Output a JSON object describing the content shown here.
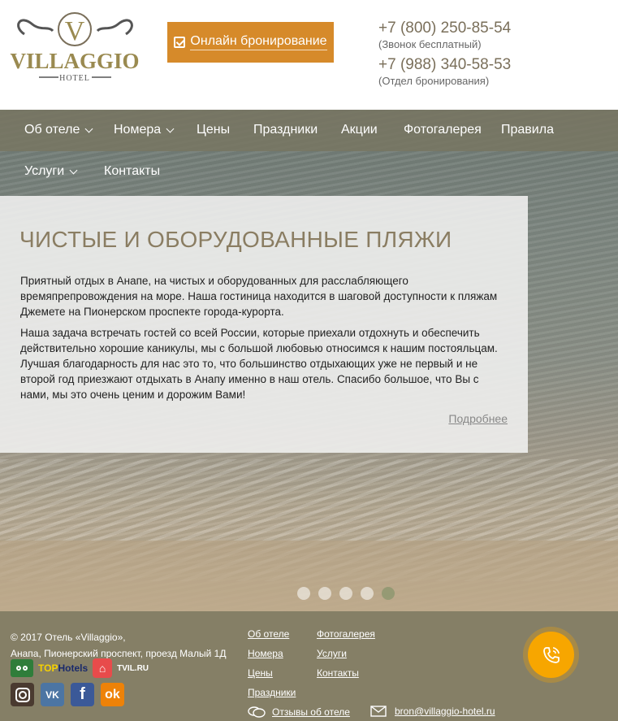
{
  "header": {
    "logo": {
      "brand": "VILLAGGIO",
      "sub": "HOTEL",
      "monogram": "V"
    },
    "booking_label": "Онлайн бронирование",
    "phones": [
      {
        "number": "+7 (800) 250-85-54",
        "note": "(Звонок бесплатный)"
      },
      {
        "number": "+7 (988) 340-58-53",
        "note": "(Отдел бронирования)"
      }
    ]
  },
  "nav": {
    "items": [
      {
        "label": "Об отеле",
        "dropdown": true
      },
      {
        "label": "Номера",
        "dropdown": true
      },
      {
        "label": "Цены"
      },
      {
        "label": "Праздники"
      },
      {
        "label": "Акции"
      },
      {
        "label": "Фотогалерея"
      },
      {
        "label": "Правила"
      },
      {
        "label": "Услуги",
        "dropdown": true
      },
      {
        "label": "Контакты"
      }
    ]
  },
  "hero": {
    "title": "ЧИСТЫЕ И ОБОРУДОВАННЫЕ ПЛЯЖИ",
    "paragraph1": "Приятный отдых в Анапе, на чистых и оборудованных для расслабляющего времяпрепровождения на море. Наша гостиница находится в шаговой доступности к пляжам Джемете на Пионерском проспекте города-курорта.",
    "paragraph2": "Наша задача встречать гостей со всей России, которые приехали отдохнуть и обеспечить действительно хорошие каникулы, мы с большой любовью относимся к нашим постояльцам. Лучшая благодарность для нас это то, что большинство отдыхающих уже не первый и не второй год приезжают отдыхать в Анапу именно в наш отель. Спасибо большое, что Вы с нами, мы это очень ценим и дорожим Вами!",
    "more_label": "Подробнее",
    "slides_count": 5,
    "active_slide": 5
  },
  "footer": {
    "copyright": "© 2017 Отель «Villaggio»,",
    "address": "Анапа, Пионерский проспект, проезд Малый 1Д",
    "badges": {
      "top_hotels": "TOP",
      "top_hotels_b": "Hotels",
      "tvil": "TVIL.RU"
    },
    "socials": {
      "vk": "VK",
      "fb": "f",
      "ok": "ok"
    },
    "links_col1": [
      "Об отеле",
      "Номера",
      "Цены",
      "Праздники"
    ],
    "links_col2": [
      "Фотогалерея",
      "Услуги",
      "Контакты"
    ],
    "reviews_label": "Отзывы об отеле",
    "email": "bron@villaggio-hotel.ru"
  },
  "colors": {
    "accent": "#d68a2a",
    "nav": "#787662",
    "footer": "#857f66",
    "title": "#8a7d62",
    "call": "#f7a600"
  },
  "icons": [
    "check-square-icon",
    "chevron-down-icon",
    "tripadvisor-icon",
    "tvil-house-icon",
    "instagram-icon",
    "vk-icon",
    "facebook-icon",
    "odnoklassniki-icon",
    "phone-call-icon",
    "chat-bubble-icon",
    "envelope-icon"
  ]
}
